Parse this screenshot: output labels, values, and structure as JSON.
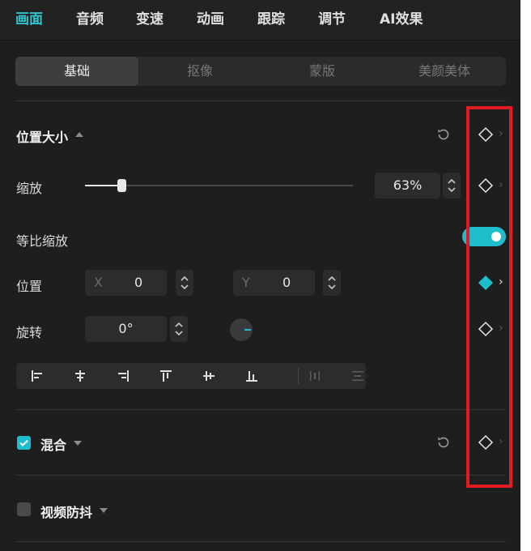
{
  "top_tabs": [
    "画面",
    "音频",
    "变速",
    "动画",
    "跟踪",
    "调节",
    "AI效果"
  ],
  "active_top_tab": "画面",
  "sub_tabs": [
    "基础",
    "抠像",
    "蒙版",
    "美颜美体"
  ],
  "active_sub_tab": "基础",
  "position_size": {
    "title": "位置大小",
    "scale": {
      "label": "缩放",
      "value": "63%",
      "slider_fraction": 0.135
    },
    "uniform_scale": {
      "label": "等比缩放",
      "enabled": true
    },
    "position": {
      "label": "位置",
      "x_label": "X",
      "x_value": "0",
      "y_label": "Y",
      "y_value": "0"
    },
    "rotation": {
      "label": "旋转",
      "value": "0°"
    }
  },
  "blend": {
    "title": "混合",
    "checked": true
  },
  "stabilize": {
    "title": "视频防抖",
    "checked": false
  },
  "colors": {
    "accent": "#2cc6d3",
    "toggle": "#1fbccb",
    "highlight": "#e11b22",
    "background": "#1e1e1f"
  },
  "icons": {
    "reset": "reset-icon",
    "keyframe": "keyframe-diamond-icon",
    "keyframe_active": "keyframe-diamond-filled-icon",
    "stepper": "stepper-icon",
    "check": "check-icon"
  }
}
